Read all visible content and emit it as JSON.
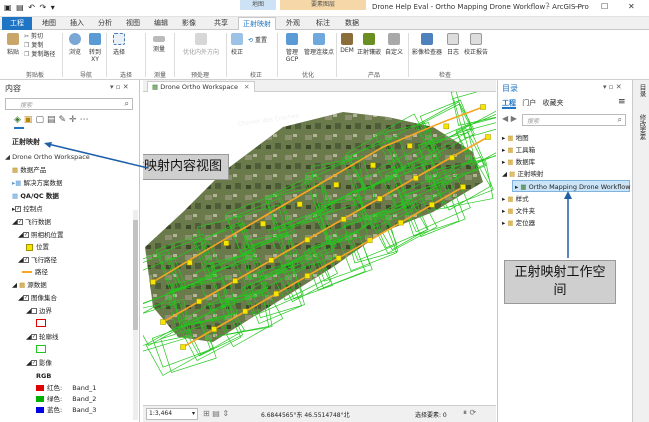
{
  "window": {
    "title": "Drone Help Eval - Ortho Mapping Drone Workflow - ArcGIS Pro",
    "minimize": "—",
    "maximize": "☐",
    "close": "✕"
  },
  "context_tabs": {
    "map": "地图",
    "imagery": "要素图层"
  },
  "quick_access": [
    "▣",
    "▤",
    "↶",
    "↷",
    "▾"
  ],
  "tabs": [
    "工程",
    "地图",
    "插入",
    "分析",
    "视图",
    "编辑",
    "影像",
    "共享",
    "正射映射",
    "外观",
    "标注",
    "数据"
  ],
  "ribbon": {
    "groups": [
      "剪贴板",
      "导航",
      "选择",
      "测量",
      "预处理",
      "校正",
      "优化",
      "产品",
      "检查"
    ],
    "buttons": {
      "paste": "粘贴",
      "cut": "剪切",
      "copy": "复制",
      "copy_path": "复制路径",
      "explore": "浏览",
      "goto": "转到XY",
      "select": "选择",
      "measure": "测量",
      "image_lock": "优化内外方向",
      "adjust": "校正",
      "reset": "重置",
      "manage_gcp": "管理GCP",
      "manage_tie": "管理连接点",
      "dem": "DEM",
      "ortho": "正射镶嵌",
      "custom": "自定义",
      "inspector": "影像检查器",
      "log": "日志",
      "report": "校正报告"
    }
  },
  "contents": {
    "title": "内容",
    "search_placeholder": "搜索",
    "section": "正射映射",
    "items": [
      {
        "label": "Drone Ortho Workspace"
      },
      {
        "label": "数据产品"
      },
      {
        "label": "解决方案数据"
      },
      {
        "label": "QA/QC 数据"
      },
      {
        "label": "控制点"
      },
      {
        "label": "飞行数据"
      },
      {
        "label": "照相机位置"
      },
      {
        "label": "位置"
      },
      {
        "label": "飞行路径"
      },
      {
        "label": "路径"
      },
      {
        "label": "源数据"
      },
      {
        "label": "图像集合"
      },
      {
        "label": "边界"
      },
      {
        "label": "轮廓线"
      },
      {
        "label": "影像"
      },
      {
        "label": "RGB"
      },
      {
        "label": "红色:",
        "value": "Band_1"
      },
      {
        "label": "绿色:",
        "value": "Band_2"
      },
      {
        "label": "蓝色:",
        "value": "Band_3"
      }
    ]
  },
  "map_view": {
    "tab_label": "Drone Ortho Workspace",
    "tab_close": "✕",
    "road_label": "Chemin des Crocheu"
  },
  "status": {
    "scale": "1:3,464",
    "coords": "6.6844565°东 46.5514748°北",
    "selected": "选择要素: 0"
  },
  "callouts": {
    "contents_view": "正射映射内容视图",
    "workspace": "正射映射工作空间"
  },
  "catalog": {
    "title": "目录",
    "tabs": [
      "工程",
      "门户",
      "收藏夹"
    ],
    "search_placeholder": "搜索",
    "items": [
      "地图",
      "工具箱",
      "数据库",
      "正射映射",
      "Ortho Mapping Drone Workflow",
      "样式",
      "文件夹",
      "定位器"
    ]
  },
  "side_tabs": [
    "目录",
    "修改要素"
  ],
  "colors": {
    "accent": "#1f74c3",
    "flight": "#22c71d",
    "path": "#f5a623",
    "red": "#e00000",
    "green": "#00b000",
    "blue": "#0000e0"
  }
}
